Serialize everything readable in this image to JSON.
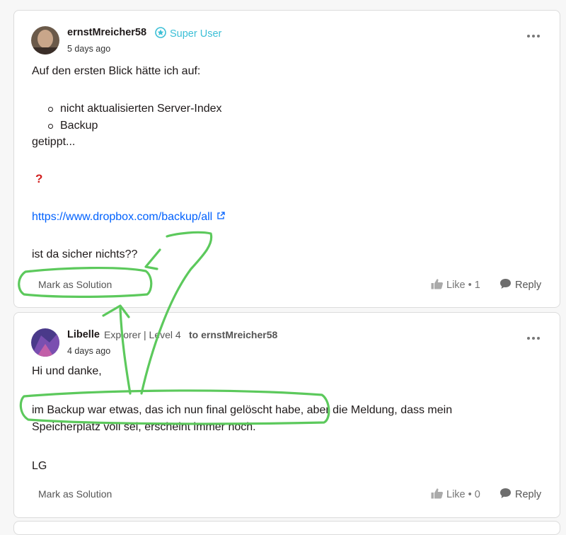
{
  "posts": [
    {
      "username": "ernstMreicher58",
      "rank": "Super User",
      "date": "5 days ago",
      "body": {
        "intro": "Auf den ersten Blick hätte ich auf:",
        "bullets": [
          "nicht aktualisierten Server-Index",
          "Backup"
        ],
        "after": "getippt...",
        "question_mark": "?",
        "link": "https://www.dropbox.com/backup/all",
        "closing": "ist da sicher nichts??"
      },
      "mark_solution": "Mark as Solution",
      "like_label": "Like",
      "like_count": "1",
      "reply_label": "Reply"
    },
    {
      "username": "Libelle",
      "rank": "Explorer | Level 4",
      "to_user": "to ernstMreicher58",
      "date": "4 days ago",
      "body": {
        "line1": "Hi und danke,",
        "line2": "im Backup war etwas, das ich nun final gelöscht habe, aber die Meldung, dass mein",
        "line3": "Speicherplatz voll sei, erscheint immer noch.",
        "line4": "LG"
      },
      "mark_solution": "Mark as Solution",
      "like_label": "Like",
      "like_count": "0",
      "reply_label": "Reply"
    }
  ],
  "colors": {
    "annotation": "#5cc95c",
    "link": "#0061fe",
    "rank": "#3bbfd6"
  }
}
